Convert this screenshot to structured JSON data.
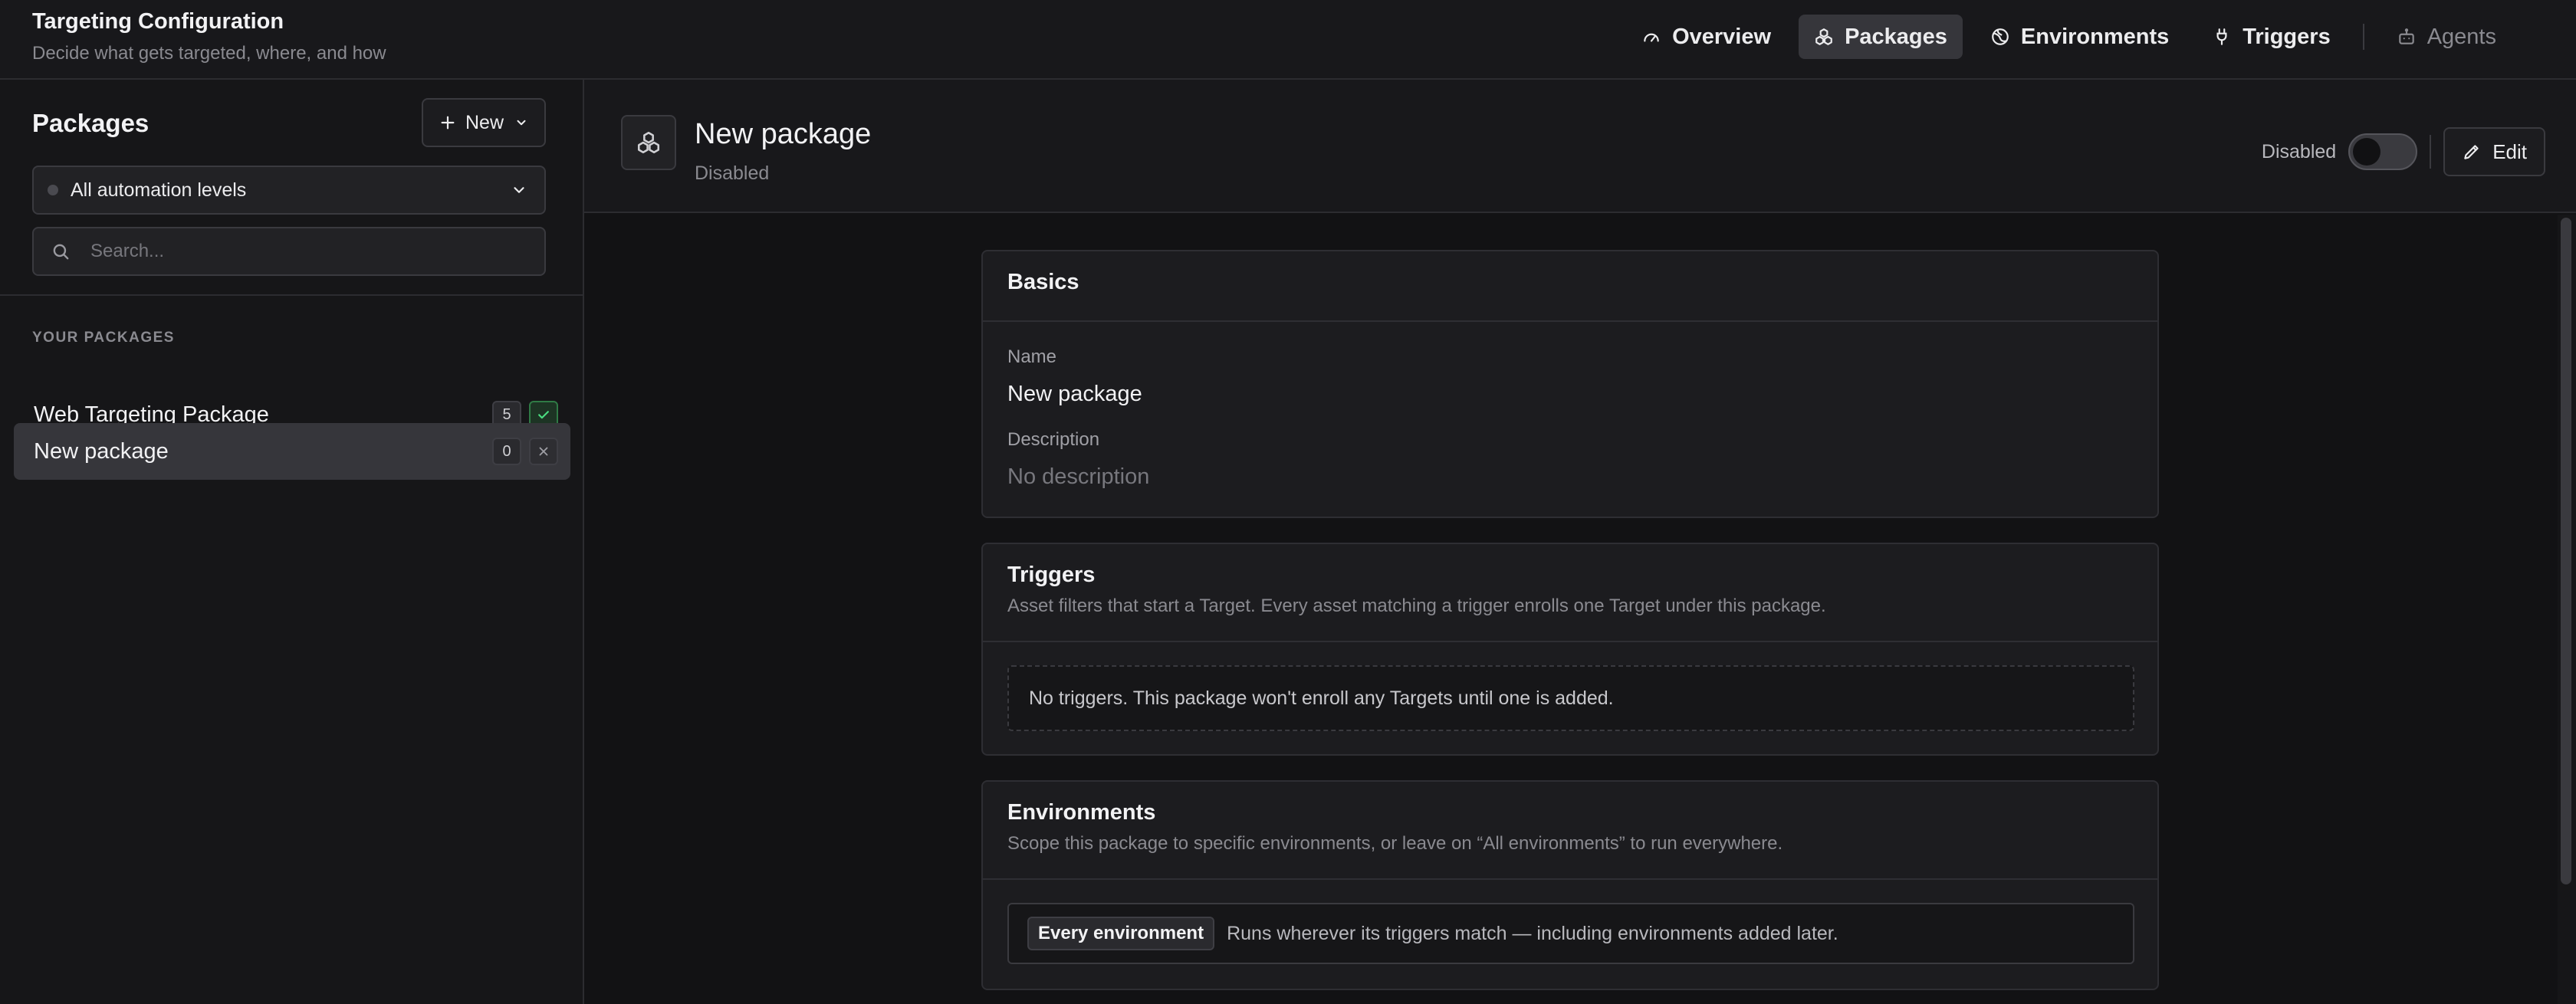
{
  "header": {
    "title": "Targeting Configuration",
    "subtitle": "Decide what gets targeted, where, and how"
  },
  "nav": {
    "items": [
      {
        "label": "Overview",
        "icon": "gauge-icon",
        "state": "default"
      },
      {
        "label": "Packages",
        "icon": "packages-icon",
        "state": "active"
      },
      {
        "label": "Environments",
        "icon": "globe-icon",
        "state": "default"
      },
      {
        "label": "Triggers",
        "icon": "plug-icon",
        "state": "default"
      },
      {
        "label": "Agents",
        "icon": "robot-icon",
        "state": "muted"
      }
    ]
  },
  "sidebar": {
    "title": "Packages",
    "new_button": "New",
    "level_filter": "All automation levels",
    "search_placeholder": "Search...",
    "section_label": "YOUR PACKAGES",
    "packages": [
      {
        "name": "Web Targeting Package",
        "count": "5",
        "status": "enabled",
        "selected": false
      },
      {
        "name": "New package",
        "count": "0",
        "status": "disabled",
        "selected": true
      }
    ]
  },
  "package": {
    "title": "New package",
    "status": "Disabled",
    "toggle_label": "Disabled",
    "toggle_on": false,
    "edit_button": "Edit"
  },
  "basics": {
    "title": "Basics",
    "name_label": "Name",
    "name_value": "New package",
    "description_label": "Description",
    "description_value": "No description"
  },
  "triggers": {
    "title": "Triggers",
    "description": "Asset filters that start a Target. Every asset matching a trigger enrolls one Target under this package.",
    "empty": "No triggers. This package won't enroll any Targets until one is added."
  },
  "environments": {
    "title": "Environments",
    "description": "Scope this package to specific environments, or leave on “All environments” to run everywhere.",
    "badge": "Every environment",
    "badge_desc": "Runs wherever its triggers match — including environments added later."
  },
  "colors": {
    "background": "#121214",
    "panel": "#1c1c1f",
    "active_nav": "#36363b",
    "success": "#2f7a45"
  }
}
